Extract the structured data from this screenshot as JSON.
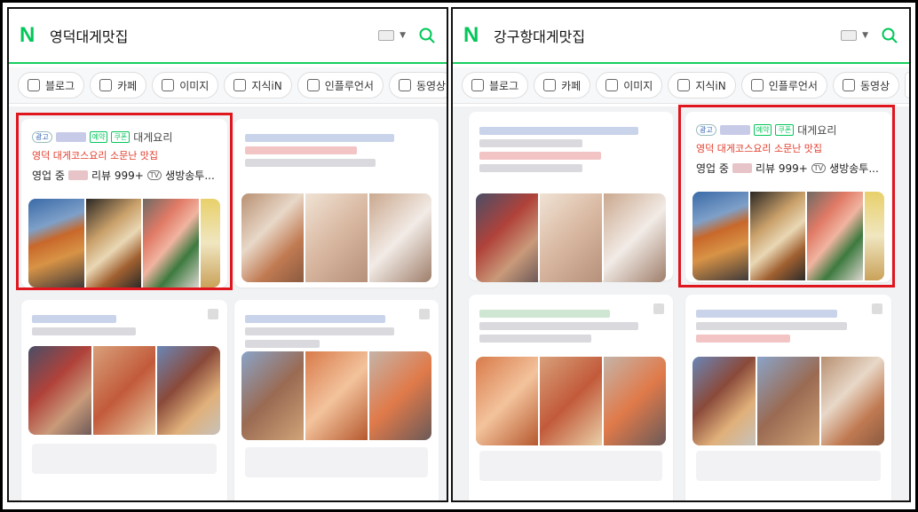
{
  "left": {
    "query": "영덕대게맛집",
    "ad": {
      "ad_label": "광고",
      "booking_badge": "예약",
      "coupon_badge": "쿠폰",
      "category": "대게요리",
      "promo": "영덕 대게코스요리 소문난 맛집",
      "status": "영업 중",
      "reviews": "리뷰 999+",
      "tv_label": "TV",
      "tv_text": "생방송투..."
    }
  },
  "right": {
    "query": "강구항대게맛집",
    "ad": {
      "ad_label": "광고",
      "booking_badge": "예약",
      "coupon_badge": "쿠폰",
      "category": "대게요리",
      "promo": "영덕 대게코스요리 소문난 맛집",
      "status": "영업 중",
      "reviews": "리뷰 999+",
      "tv_label": "TV",
      "tv_text": "생방송투..."
    }
  },
  "tabs": [
    "블로그",
    "카페",
    "이미지",
    "지식iN",
    "인플루언서",
    "동영상"
  ],
  "logo": "N",
  "colors": {
    "brand": "#03c75a",
    "highlight": "#e0161f",
    "promo": "#e23d2b"
  },
  "icons": [
    "naver-logo",
    "keyboard-icon",
    "search-icon",
    "chevron-right-icon",
    "more-icon",
    "tv-icon",
    "bookmark-icon"
  ]
}
